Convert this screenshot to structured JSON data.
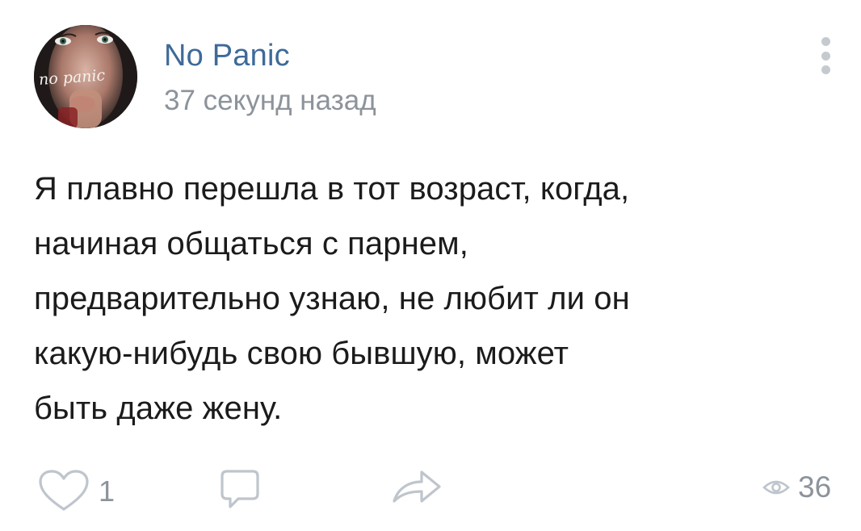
{
  "post": {
    "author": {
      "name": "No Panic",
      "avatar_text": "no panic",
      "avatar_icon": "avatar-image"
    },
    "timestamp": "37 секунд назад",
    "menu_icon": "more-vertical-icon",
    "text_lines": [
      "Я плавно перешла в тот возраст, когда,",
      "начиная общаться с парнем,",
      "предварительно узнаю, не любит ли он",
      "какую-нибудь свою бывшую, может",
      "быть даже жену."
    ],
    "actions": {
      "like": {
        "icon": "heart-icon",
        "count": "1"
      },
      "comment": {
        "icon": "comment-icon"
      },
      "share": {
        "icon": "share-icon"
      },
      "views": {
        "icon": "eye-icon",
        "count": "36"
      }
    }
  },
  "colors": {
    "author_name": "#3f6a99",
    "secondary_text": "#8c939b",
    "body_text": "#1b1b1b",
    "icon_gray": "#c5cad0"
  }
}
